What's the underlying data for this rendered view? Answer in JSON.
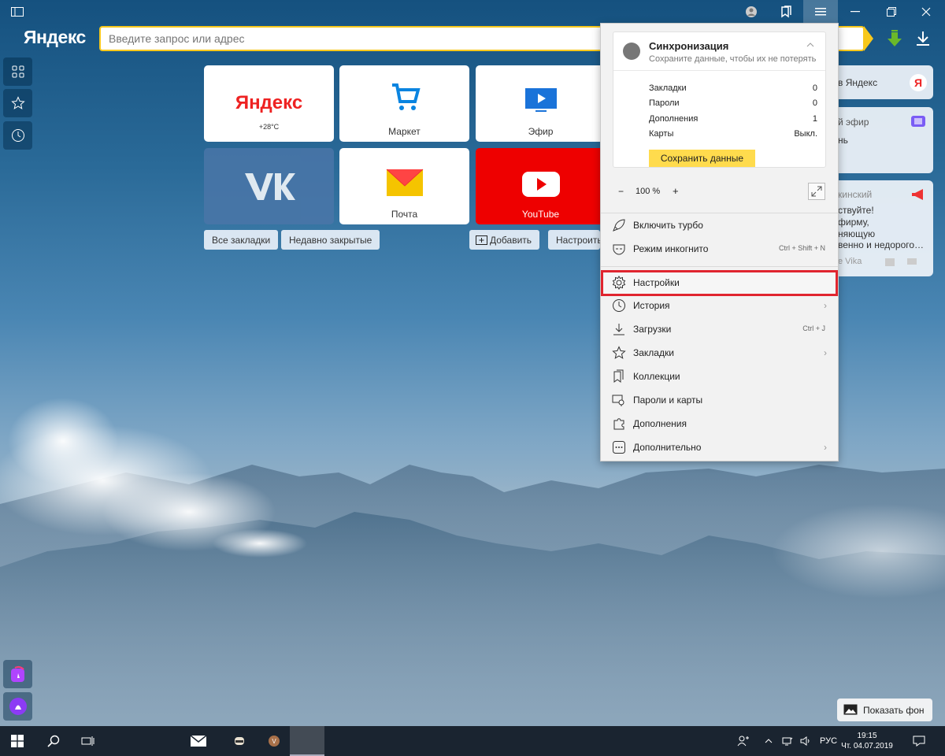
{
  "browser": {
    "logo": "Яндекс",
    "address_placeholder": "Введите запрос или адрес"
  },
  "tiles": [
    {
      "name": "Яндекс",
      "sub": "+28°C"
    },
    {
      "name": "Маркет"
    },
    {
      "name": "Эфир"
    },
    {
      "name": "VK"
    },
    {
      "name": "Почта"
    },
    {
      "name": "YouTube"
    }
  ],
  "bookmark_pills": {
    "all_bookmarks": "Все закладки",
    "recently_closed": "Недавно закрытые",
    "add": "Добавить",
    "customize": "Настроить"
  },
  "widgets": {
    "w1_text": "в Яндекс",
    "w2_line1": "й эфир",
    "w2_line2": "нь",
    "w3_title": "кинский",
    "w3_l1": "ствуйте!",
    "w3_l2": "фирму,",
    "w3_l3": "няющую",
    "w3_l4": "венно и недорого…",
    "w3_footer": "e Vika"
  },
  "menu": {
    "sync": {
      "title": "Синхронизация",
      "subtitle": "Сохраните данные, чтобы их не потерять",
      "rows": [
        {
          "label": "Закладки",
          "value": "0"
        },
        {
          "label": "Пароли",
          "value": "0"
        },
        {
          "label": "Дополнения",
          "value": "1"
        },
        {
          "label": "Карты",
          "value": "Выкл."
        }
      ],
      "save_button": "Сохранить данные"
    },
    "zoom": {
      "minus": "−",
      "value": "100 %",
      "plus": "+"
    },
    "items": [
      {
        "label": "Включить турбо",
        "shortcut": ""
      },
      {
        "label": "Режим инкогнито",
        "shortcut": "Ctrl + Shift + N"
      },
      {
        "label": "Настройки",
        "shortcut": ""
      },
      {
        "label": "История",
        "shortcut": ""
      },
      {
        "label": "Загрузки",
        "shortcut": "Ctrl + J"
      },
      {
        "label": "Закладки",
        "shortcut": ""
      },
      {
        "label": "Коллекции",
        "shortcut": ""
      },
      {
        "label": "Пароли и карты",
        "shortcut": ""
      },
      {
        "label": "Дополнения",
        "shortcut": ""
      },
      {
        "label": "Дополнительно",
        "shortcut": ""
      }
    ]
  },
  "show_background": "Показать фон",
  "taskbar": {
    "lang": "РУС",
    "time": "19:15",
    "date": "Чт. 04.07.2019",
    "avatar_letter": "V"
  },
  "colors": {
    "accent_yellow": "#ffdb4d",
    "highlight_red": "#e0252f",
    "youtube_red": "#ee0000",
    "vk_blue": "#4a76a8"
  }
}
